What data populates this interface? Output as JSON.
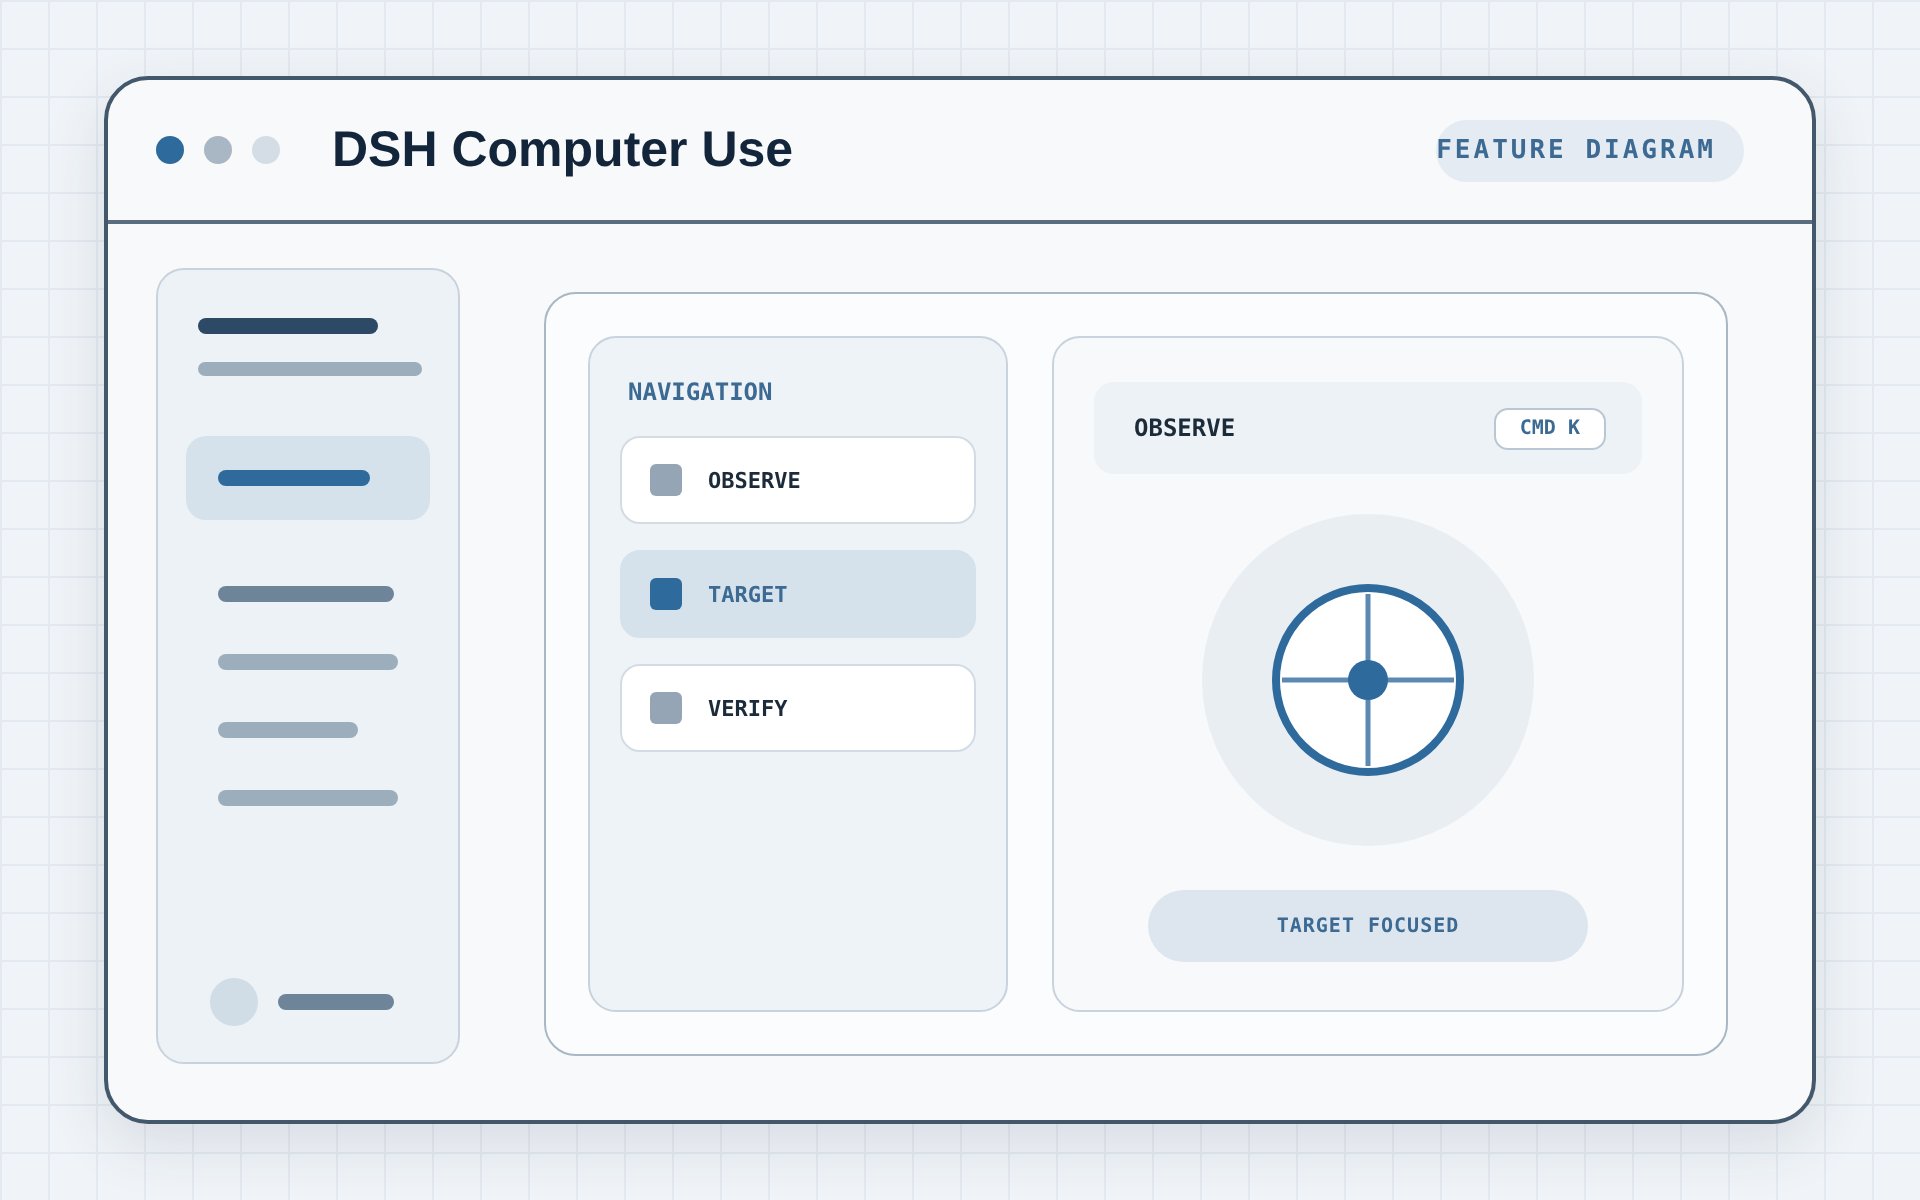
{
  "window": {
    "title": "DSH Computer Use",
    "badge": "FEATURE DIAGRAM"
  },
  "sidebar": {
    "items": [
      {
        "selected": true
      },
      {
        "selected": false
      },
      {
        "selected": false
      },
      {
        "selected": false
      },
      {
        "selected": false
      }
    ]
  },
  "navigation": {
    "heading": "NAVIGATION",
    "items": [
      {
        "label": "OBSERVE",
        "selected": false
      },
      {
        "label": "TARGET",
        "selected": true
      },
      {
        "label": "VERIFY",
        "selected": false
      }
    ]
  },
  "detail": {
    "title": "OBSERVE",
    "shortcut": "CMD K",
    "status": "TARGET FOCUSED"
  }
}
